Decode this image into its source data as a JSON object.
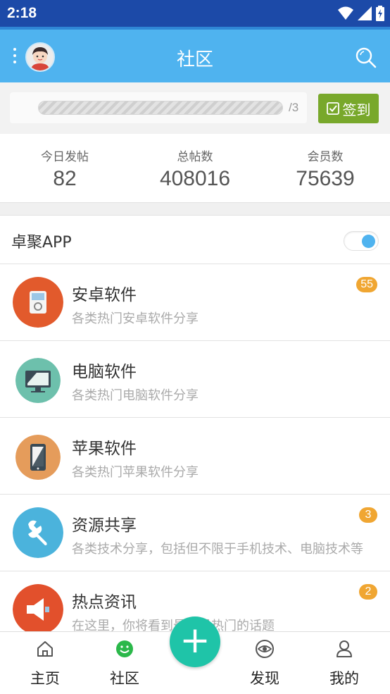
{
  "statusbar": {
    "time": "2:18",
    "icons": [
      "wifi-icon",
      "signal-icon",
      "battery-icon"
    ]
  },
  "appbar": {
    "title": "社区",
    "menu_icon": "more-vert-icon",
    "avatar": "user-avatar",
    "search_icon": "search-icon"
  },
  "signin": {
    "progress": 0,
    "fraction": "/3",
    "button_label": "签到",
    "button_icon": "checkbox-icon"
  },
  "stats": [
    {
      "label": "今日发帖",
      "value": "82"
    },
    {
      "label": "总帖数",
      "value": "408016"
    },
    {
      "label": "会员数",
      "value": "75639"
    }
  ],
  "section": {
    "title": "卓聚APP",
    "toggle_on": true
  },
  "forums": [
    {
      "name": "安卓软件",
      "desc": "各类热门安卓软件分享",
      "badge": "55",
      "icon": "android-device-icon",
      "color": "#e25a2c"
    },
    {
      "name": "电脑软件",
      "desc": "各类热门电脑软件分享",
      "badge": "",
      "icon": "computer-monitor-icon",
      "color": "#6dc0ac"
    },
    {
      "name": "苹果软件",
      "desc": "各类热门苹果软件分享",
      "badge": "",
      "icon": "phone-icon",
      "color": "#e59c5b"
    },
    {
      "name": "资源共享",
      "desc": "各类技术分享，包括但不限于手机技术、电脑技术等",
      "badge": "3",
      "icon": "wrench-icon",
      "color": "#4bb3dc"
    },
    {
      "name": "热点资讯",
      "desc": "在这里，你将看到最新最热门的话题",
      "badge": "2",
      "icon": "megaphone-icon",
      "color": "#e2502c"
    }
  ],
  "tabs": [
    {
      "label": "主页",
      "icon": "home-icon"
    },
    {
      "label": "社区",
      "icon": "community-smile-icon"
    },
    {
      "label": "发现",
      "icon": "eye-icon"
    },
    {
      "label": "我的",
      "icon": "person-icon"
    }
  ],
  "fab": {
    "label": "+",
    "icon": "plus-icon"
  },
  "colors": {
    "appbar": "#4fb3ef",
    "statusbar": "#1c4aa8",
    "sign_button": "#78a82b",
    "badge": "#f0a632",
    "fab": "#1fc4a8",
    "active_tab": "#2bb84a"
  }
}
